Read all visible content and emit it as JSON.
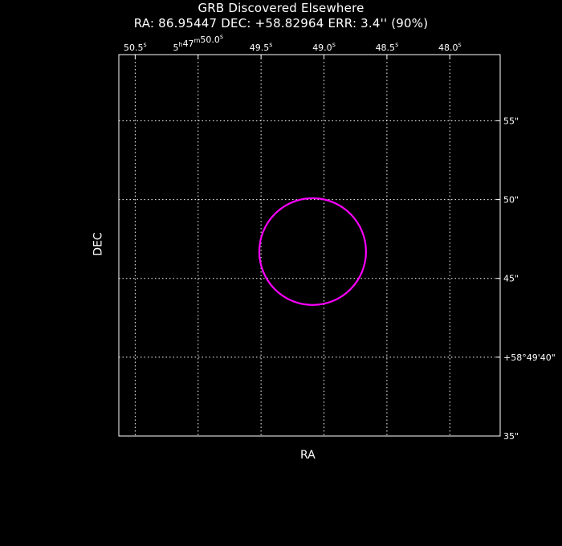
{
  "title": "GRB Discovered Elsewhere",
  "subtitle": "RA: 86.95447   DEC: +58.82964   ERR: 3.4'' (90%)",
  "colors": {
    "background": "#000000",
    "frame": "#ffffff",
    "grid": "#ffffff",
    "error_circle": "#ff00ff"
  },
  "chart_data": {
    "type": "scatter",
    "title": "GRB Discovered Elsewhere",
    "subtitle": "RA: 86.95447   DEC: +58.82964   ERR: 3.4'' (90%)",
    "xlabel": "RA",
    "ylabel": "DEC",
    "grid": true,
    "x_axis": {
      "unit": "RA seconds of time (5h47m...)",
      "range": [
        50.63,
        47.6
      ],
      "ticks": [
        {
          "value": 50.5,
          "main": "50.5",
          "sup": "s"
        },
        {
          "value": 50.0,
          "main": "5",
          "sup": "h",
          "main2": "47",
          "sup2": "m",
          "main3": "50.0",
          "sup3": "s"
        },
        {
          "value": 49.5,
          "main": "49.5",
          "sup": "s"
        },
        {
          "value": 49.0,
          "main": "49.0",
          "sup": "s"
        },
        {
          "value": 48.5,
          "main": "48.5",
          "sup": "s"
        },
        {
          "value": 48.0,
          "main": "48.0",
          "sup": "s"
        }
      ]
    },
    "y_axis": {
      "unit": "Dec arcseconds (+58°49'...)",
      "range": [
        35,
        59.2
      ],
      "ticks": [
        {
          "value": 35,
          "label": "35\""
        },
        {
          "value": 40,
          "label": "+58°49'40\""
        },
        {
          "value": 45,
          "label": "45\""
        },
        {
          "value": 50,
          "label": "50\""
        },
        {
          "value": 55,
          "label": "55\""
        }
      ]
    },
    "error_circle": {
      "ra_sec": 49.09,
      "dec_arcsec": 46.7,
      "radius_arcsec": 3.4,
      "confidence": "90%"
    }
  }
}
